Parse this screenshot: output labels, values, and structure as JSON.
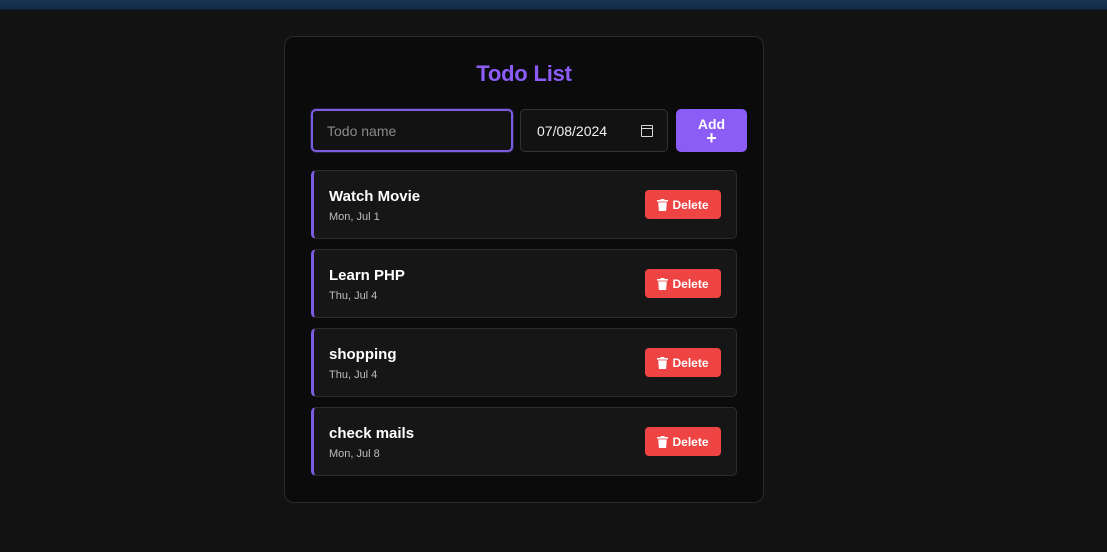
{
  "title": "Todo List",
  "form": {
    "name_placeholder": "Todo name",
    "date_value": "07/08/2024",
    "add_label": "Add",
    "add_icon": "plus-icon"
  },
  "todos": [
    {
      "name": "Watch Movie",
      "date": "Mon, Jul 1",
      "delete_label": "Delete"
    },
    {
      "name": "Learn PHP",
      "date": "Thu, Jul 4",
      "delete_label": "Delete"
    },
    {
      "name": "shopping",
      "date": "Thu, Jul 4",
      "delete_label": "Delete"
    },
    {
      "name": "check mails",
      "date": "Mon, Jul 8",
      "delete_label": "Delete"
    }
  ],
  "colors": {
    "accent": "#8b5cf6",
    "danger": "#ef4444",
    "background": "#121212",
    "card": "#0b0b0b"
  }
}
